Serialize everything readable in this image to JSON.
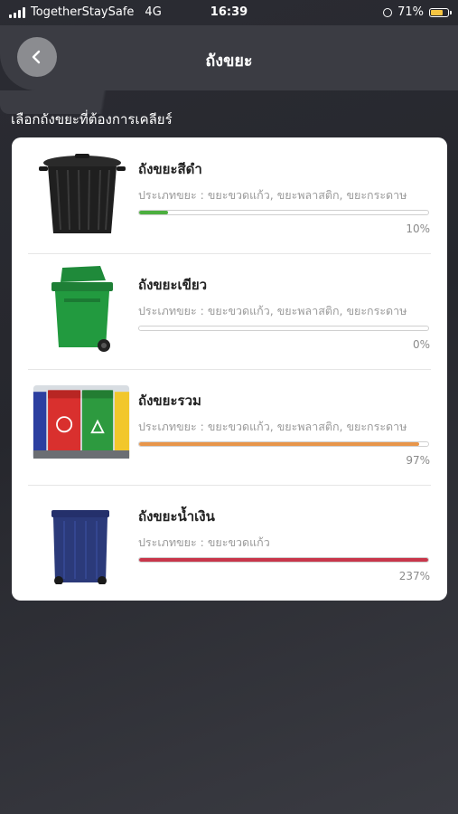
{
  "status_bar": {
    "carrier": "TogetherStaySafe",
    "network": "4G",
    "time": "16:39",
    "battery": "71%",
    "battery_color": "#f6c542"
  },
  "header": {
    "title": "ถังขยะ",
    "back_icon": "chevron-left-icon"
  },
  "section_label": "เลือกถังขยะที่ต้องการเคลียร์",
  "bins": [
    {
      "name": "ถังขยะสีดำ",
      "type": "ประเภทขยะ : ขยะขวดแก้ว, ขยะพลาสติก, ขยะกระดาษ",
      "percent_label": "10%",
      "fill_fraction": 0.1,
      "bar_color": "#4caf3f",
      "icon": "black-bin-icon"
    },
    {
      "name": "ถังขยะเขียว",
      "type": "ประเภทขยะ : ขยะขวดแก้ว, ขยะพลาสติก, ขยะกระดาษ",
      "percent_label": "0%",
      "fill_fraction": 0,
      "bar_color": "#4caf3f",
      "icon": "green-bin-icon"
    },
    {
      "name": "ถังขยะรวม",
      "type": "ประเภทขยะ : ขยะขวดแก้ว, ขยะพลาสติก, ขยะกระดาษ",
      "percent_label": "97%",
      "fill_fraction": 0.97,
      "bar_color": "#e8964a",
      "icon": "recycling-bins-icon"
    },
    {
      "name": "ถังขยะน้ำเงิน",
      "type": "ประเภทขยะ : ขยะขวดแก้ว",
      "percent_label": "237%",
      "fill_fraction": 1,
      "bar_color": "#c8364a",
      "icon": "blue-bin-icon"
    }
  ]
}
